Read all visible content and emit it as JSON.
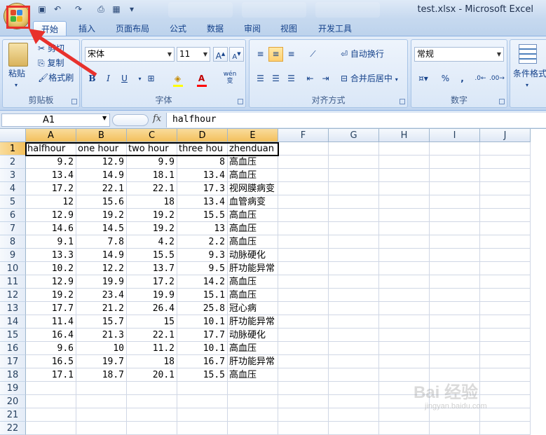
{
  "window": {
    "title": "test.xlsx - Microsoft Excel"
  },
  "tabs": [
    {
      "label": "开始",
      "active": true
    },
    {
      "label": "插入"
    },
    {
      "label": "页面布局"
    },
    {
      "label": "公式"
    },
    {
      "label": "数据"
    },
    {
      "label": "审阅"
    },
    {
      "label": "视图"
    },
    {
      "label": "开发工具"
    }
  ],
  "ribbon": {
    "clipboard": {
      "label": "剪贴板",
      "paste": "粘贴",
      "cut": "剪切",
      "copy": "复制",
      "format_painter": "格式刷"
    },
    "font": {
      "label": "字体",
      "font_name": "宋体",
      "font_size": "11",
      "bold": "B",
      "italic": "I",
      "underline": "U",
      "phonetic": "wén"
    },
    "alignment": {
      "label": "对齐方式",
      "wrap": "自动换行",
      "merge": "合并后居中"
    },
    "number": {
      "label": "数字",
      "format": "常规",
      "percent": "%",
      "comma": ","
    },
    "styles": {
      "cond_format": "条件格式"
    }
  },
  "formula_bar": {
    "name_box": "A1",
    "fx": "fx",
    "formula": "halfhour"
  },
  "columns": [
    "A",
    "B",
    "C",
    "D",
    "E",
    "F",
    "G",
    "H",
    "I",
    "J"
  ],
  "rows": [
    "1",
    "2",
    "3",
    "4",
    "5",
    "6",
    "7",
    "8",
    "9",
    "10",
    "11",
    "12",
    "13",
    "14",
    "15",
    "16",
    "17",
    "18",
    "19",
    "20",
    "21",
    "22"
  ],
  "header_row": [
    "halfhour",
    "one hour",
    "two hour",
    "three hou",
    "zhenduan"
  ],
  "table": [
    [
      "9.2",
      "12.9",
      "9.9",
      "8",
      "高血压"
    ],
    [
      "13.4",
      "14.9",
      "18.1",
      "13.4",
      "高血压"
    ],
    [
      "17.2",
      "22.1",
      "22.1",
      "17.3",
      "视网膜病变"
    ],
    [
      "12",
      "15.6",
      "18",
      "13.4",
      "血管病变"
    ],
    [
      "12.9",
      "19.2",
      "19.2",
      "15.5",
      "高血压"
    ],
    [
      "14.6",
      "14.5",
      "19.2",
      "13",
      "高血压"
    ],
    [
      "9.1",
      "7.8",
      "4.2",
      "2.2",
      "高血压"
    ],
    [
      "13.3",
      "14.9",
      "15.5",
      "9.3",
      "动脉硬化"
    ],
    [
      "10.2",
      "12.2",
      "13.7",
      "9.5",
      "肝功能异常"
    ],
    [
      "12.9",
      "19.9",
      "17.2",
      "14.2",
      "高血压"
    ],
    [
      "19.2",
      "23.4",
      "19.9",
      "15.1",
      "高血压"
    ],
    [
      "17.7",
      "21.2",
      "26.4",
      "25.8",
      "冠心病"
    ],
    [
      "11.4",
      "15.7",
      "15",
      "10.1",
      "肝功能异常"
    ],
    [
      "16.4",
      "21.3",
      "22.1",
      "17.7",
      "动脉硬化"
    ],
    [
      "9.6",
      "10",
      "11.2",
      "10.1",
      "高血压"
    ],
    [
      "16.5",
      "19.7",
      "18",
      "16.7",
      "肝功能异常"
    ],
    [
      "17.1",
      "18.7",
      "20.1",
      "15.5",
      "高血压"
    ]
  ],
  "watermark": {
    "main": "Bai 经验",
    "sub": "jingyan.baidu.com"
  },
  "colors": {
    "highlight": "#e8312d",
    "accent": "#f3c05c"
  }
}
